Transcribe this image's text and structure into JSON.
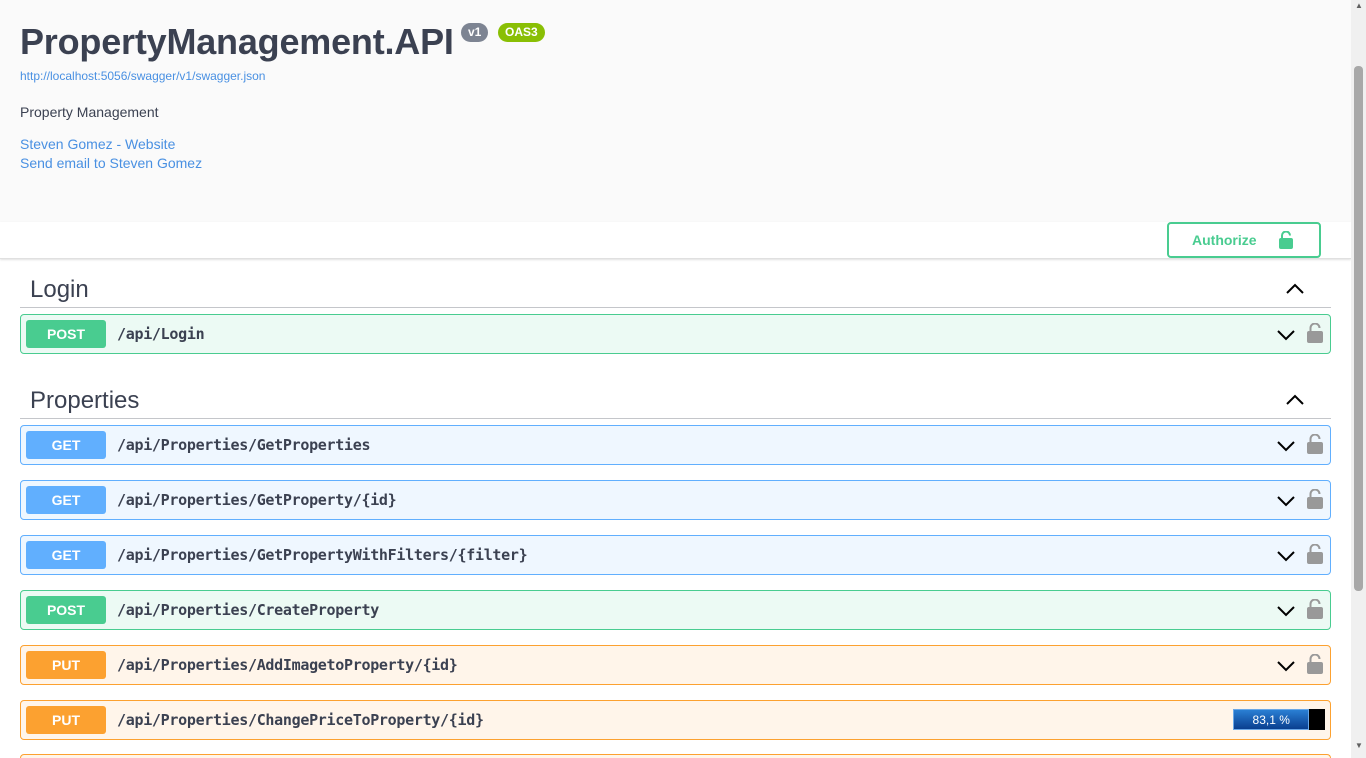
{
  "info": {
    "title": "PropertyManagement.API",
    "version_badge": "v1",
    "oas_badge": "OAS3",
    "spec_url": "http://localhost:5056/swagger/v1/swagger.json",
    "description": "Property Management",
    "contact_website": "Steven Gomez - Website",
    "contact_email": "Send email to Steven Gomez"
  },
  "scheme": {
    "authorize_label": "Authorize"
  },
  "tags": [
    {
      "name": "Login",
      "operations": [
        {
          "method": "POST",
          "path": "/api/Login"
        }
      ]
    },
    {
      "name": "Properties",
      "operations": [
        {
          "method": "GET",
          "path": "/api/Properties/GetProperties"
        },
        {
          "method": "GET",
          "path": "/api/Properties/GetProperty/{id}"
        },
        {
          "method": "GET",
          "path": "/api/Properties/GetPropertyWithFilters/{filter}"
        },
        {
          "method": "POST",
          "path": "/api/Properties/CreateProperty"
        },
        {
          "method": "PUT",
          "path": "/api/Properties/AddImagetoProperty/{id}"
        },
        {
          "method": "PUT",
          "path": "/api/Properties/ChangePriceToProperty/{id}"
        }
      ]
    }
  ],
  "overlay": {
    "progress_label": "83,1 %",
    "progress_value": 0.831
  },
  "colors": {
    "post": "#49cc90",
    "get": "#61affe",
    "put": "#fca130",
    "link": "#4990e2",
    "text": "#3b4151"
  },
  "icons": {
    "authorize": "unlocked-lock-icon",
    "operation_lock": "lock-icon",
    "expand": "chevron-down-icon",
    "collapse": "chevron-up-icon"
  }
}
